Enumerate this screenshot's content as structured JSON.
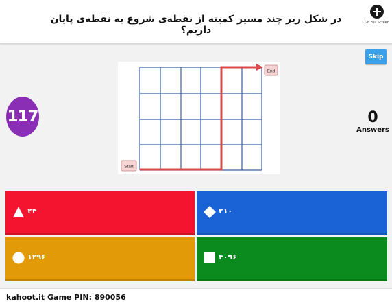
{
  "question": {
    "text": "در شکل زیر چند مسیر کمینه از نقطه‌ی شروع به نقطه‌ی پایان داریم؟"
  },
  "fullscreen": {
    "label": "Go Full Screen",
    "icon": "plus-circle-icon"
  },
  "skip": {
    "label": "Skip"
  },
  "timer": {
    "value": "117"
  },
  "answers_counter": {
    "count": "0",
    "label": "Answers"
  },
  "image": {
    "start_label": "Start",
    "end_label": "End"
  },
  "answer_options": [
    {
      "shape": "triangle-icon",
      "text": "۲۴",
      "color": "#f4142f"
    },
    {
      "shape": "diamond-icon",
      "text": "۲۱۰",
      "color": "#1a63d6"
    },
    {
      "shape": "circle-icon",
      "text": "۱۲۹۶",
      "color": "#e39a09"
    },
    {
      "shape": "square-icon",
      "text": "۴۰۹۶",
      "color": "#0b8b1d"
    }
  ],
  "footer": {
    "site": "kahoot.it",
    "game_pin_label": "Game PIN:",
    "game_pin": "890056"
  }
}
